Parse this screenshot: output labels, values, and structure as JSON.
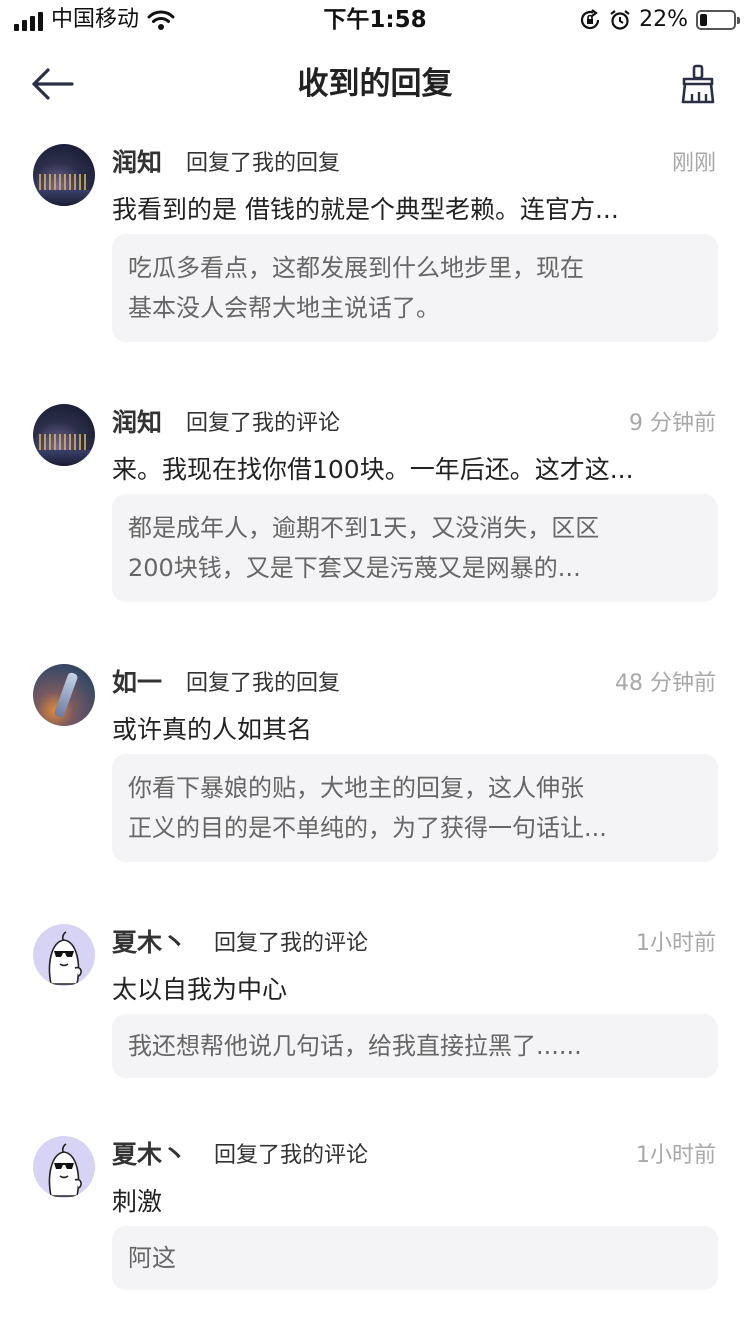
{
  "status_bar": {
    "carrier": "中国移动",
    "time": "下午1:58",
    "battery_percent": "22%",
    "battery_level": 0.22
  },
  "header": {
    "title": "收到的回复",
    "back_icon": "arrow-left-icon",
    "clear_icon": "broom-icon"
  },
  "replies": [
    {
      "name": "润知",
      "action": "回复了我的回复",
      "time": "刚刚",
      "reply": "我看到的是 借钱的就是个典型老赖。连官方...",
      "quote_line1": "吃瓜多看点，这都发展到什么地步里，现在",
      "quote_line2": "基本没人会帮大地主说话了。",
      "avatar": "city-night-avatar"
    },
    {
      "name": "润知",
      "action": "回复了我的评论",
      "time": "9 分钟前",
      "reply": "来。我现在找你借100块。一年后还。这才这...",
      "quote_line1": "都是成年人，逾期不到1天，又没消失，区区",
      "quote_line2": "200块钱，又是下套又是污蔑又是网暴的...",
      "avatar": "city-night-avatar"
    },
    {
      "name": "如一",
      "action": "回复了我的回复",
      "time": "48 分钟前",
      "reply": "或许真的人如其名",
      "quote_line1": "你看下暴娘的贴，大地主的回复，这人伸张",
      "quote_line2": "正义的目的是不单纯的，为了获得一句话让...",
      "avatar": "warrior-avatar"
    },
    {
      "name": "夏木丶",
      "action": "回复了我的评论",
      "time": "1小时前",
      "reply": "太以自我为中心",
      "quote_line1": "我还想帮他说几句话，给我直接拉黑了......",
      "avatar": "duck-sunglasses-avatar"
    },
    {
      "name": "夏木丶",
      "action": "回复了我的评论",
      "time": "1小时前",
      "reply": "刺激",
      "quote_line1": "阿这",
      "avatar": "duck-sunglasses-avatar"
    }
  ]
}
